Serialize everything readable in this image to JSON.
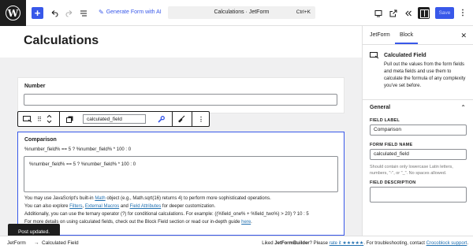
{
  "toolbar": {
    "logo_letter": "W",
    "generate_label": "Generate Form with AI",
    "doc_title": "Calculations · JetForm",
    "shortcut": "Ctrl+K",
    "save_label": "Save",
    "icons": [
      "add-icon",
      "undo-icon",
      "redo-icon",
      "document-overview-icon",
      "view-icon",
      "external-link-icon",
      "chevrons-icon",
      "sidebar-toggle-icon",
      "more-icon"
    ]
  },
  "editor": {
    "page_title": "Calculations",
    "number_block": {
      "label": "Number",
      "value": ""
    },
    "block_toolbar": {
      "field_name_value": "calculated_field"
    },
    "calc_block": {
      "title": "Comparison",
      "formula_preview": "%number_field% == 5 ? %number_field% * 100 : 0",
      "formula_value": "%number_field% == 5 ? %number_field% * 100 : 0",
      "help_line1_a": "You may use JavaScript's built-in ",
      "help_line1_link": "Math",
      "help_line1_b": " object (e.g., Math.sqrt(16) returns 4) to perform more sophisticated operations.",
      "help_line2_a": "You can also explore ",
      "help_line2_link1": "Filters",
      "help_line2_sep1": ", ",
      "help_line2_link2": "External Macros",
      "help_line2_sep2": " and ",
      "help_line2_link3": "Field Attributes",
      "help_line2_b": " for deeper customization.",
      "help_line3": "Additionally, you can use the ternary operator (?) for conditional calculations. For example: ((%field_one% + %field_two%) > 20) ? 10 : 5",
      "help_line4_a": "For more details on using calculated fields, check out the Block Field section or read our in-depth guide ",
      "help_line4_link": "here",
      "help_line4_b": "."
    },
    "snackbar": "Post updated."
  },
  "sidebar": {
    "tab_form": "JetForm",
    "tab_block": "Block",
    "close_glyph": "✕",
    "block_name": "Calculated Field",
    "block_desc": "Pull out the values from the form fields and meta fields and use them to calculate the formula of any complexity you've set before.",
    "section_title": "General",
    "section_chevron": "⌃",
    "field_label_label": "FIELD LABEL",
    "field_label_value": "Comparison",
    "field_name_label": "FORM FIELD NAME",
    "field_name_value": "calculated_field",
    "field_name_help": "Should contain only lowercase Latin letters, numbers, \"-\", or \"_\". No spaces allowed.",
    "field_desc_label": "FIELD DESCRIPTION",
    "field_desc_value": ""
  },
  "footer": {
    "crumb1": "JetForm",
    "crumb_sep": "→",
    "crumb2": "Calculated Field",
    "liked_prefix": "Liked ",
    "liked_brand": "JetFormBuilder",
    "liked_mid": "? Please ",
    "rate_link": "rate it ★★★★★",
    "liked_suffix": ". For troubleshooting, contact ",
    "support_link": "Crocoblock support",
    "end": "."
  }
}
